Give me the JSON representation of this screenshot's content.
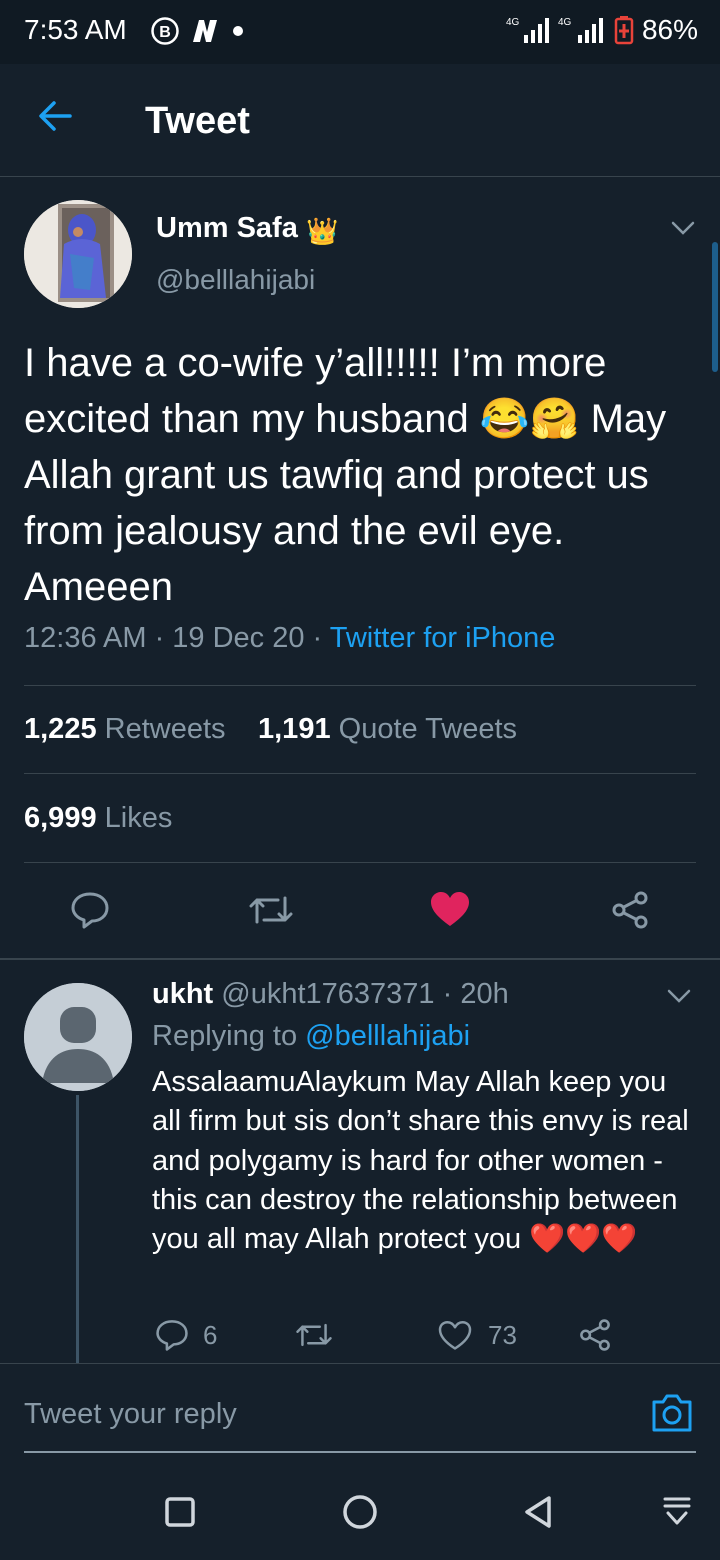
{
  "status_bar": {
    "time": "7:53 AM",
    "battery": "86%",
    "network": "4G",
    "icons": [
      "b-circle-icon",
      "n-app-icon",
      "dot-icon",
      "signal-icon",
      "signal-icon",
      "battery-icon"
    ]
  },
  "header": {
    "title": "Tweet",
    "back_icon": "arrow-left-icon"
  },
  "tweet": {
    "author_name": "Umm Safa",
    "author_emoji": "👑",
    "author_handle": "@belllahijabi",
    "text": "I have a co-wife y’all!!!!! I’m more excited than my husband 😂🤗 May Allah grant us tawfiq and protect us from jealousy and the evil eye. Ameeen",
    "time": "12:36 AM · 19 Dec 20 · ",
    "source": "Twitter for iPhone",
    "retweets_count": "1,225",
    "retweets_label": "Retweets",
    "quotes_count": "1,191",
    "quotes_label": "Quote Tweets",
    "likes_count": "6,999",
    "likes_label": "Likes"
  },
  "reply": {
    "name": "ukht",
    "handle_time": "@ukht17637371 · 20h",
    "replying_prefix": "Replying to ",
    "replying_to": "@belllahijabi",
    "text": "AssalaamuAlaykum May Allah keep you all firm but sis don’t share this envy is real and polygamy is hard for other women - this can destroy the relationship between you all may Allah protect you ❤️❤️❤️",
    "reply_count": "6",
    "like_count": "73"
  },
  "compose": {
    "placeholder": "Tweet your reply"
  },
  "colors": {
    "background": "#15202b",
    "accent": "#1da1f2",
    "secondary_text": "#8899a6",
    "like": "#e0245e",
    "divider": "#38444d"
  }
}
